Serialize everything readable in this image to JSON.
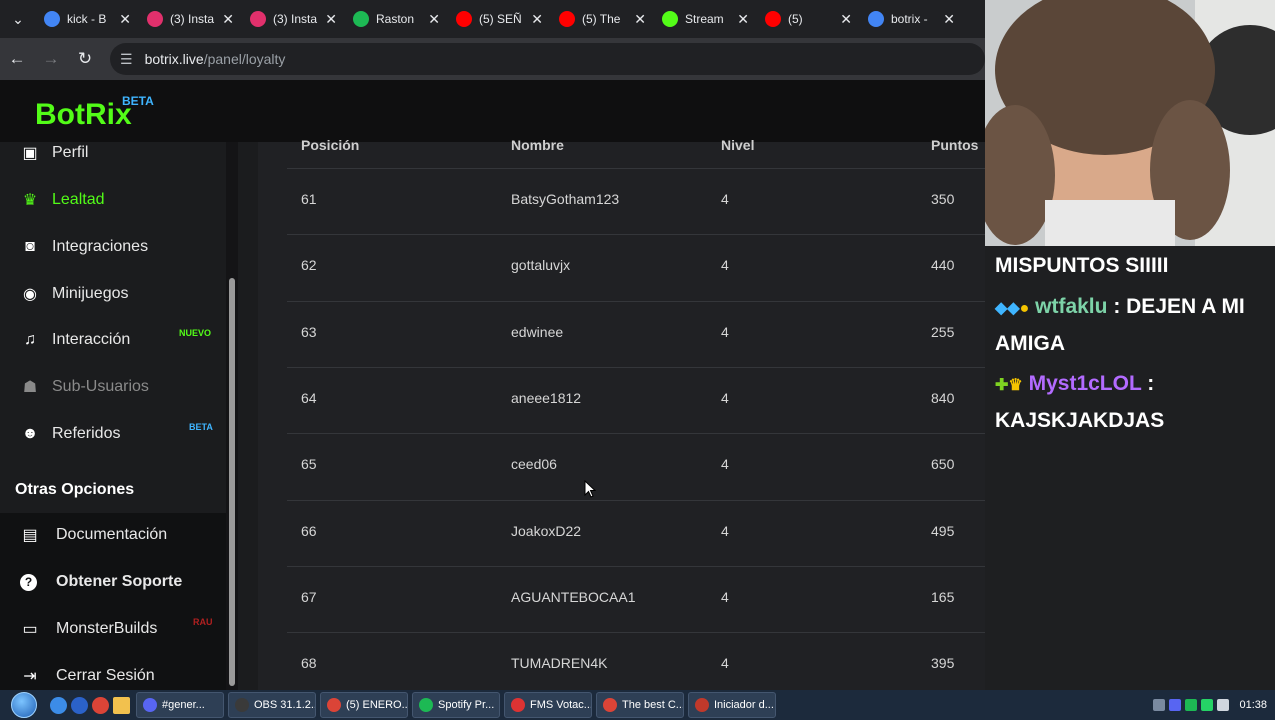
{
  "browser": {
    "tabs": [
      {
        "title": "kick - B",
        "color": "#4285f4"
      },
      {
        "title": "(3) Insta",
        "color": "#e1306c"
      },
      {
        "title": "(3) Insta",
        "color": "#e1306c"
      },
      {
        "title": "Raston",
        "color": "#1db954"
      },
      {
        "title": "(5) SEÑ",
        "color": "#ff0000"
      },
      {
        "title": "(5) The",
        "color": "#ff0000"
      },
      {
        "title": "Stream",
        "color": "#53fc18"
      },
      {
        "title": "(5)",
        "color": "#ff0000"
      },
      {
        "title": "botrix -",
        "color": "#4285f4"
      }
    ],
    "url_host": "botrix.live",
    "url_path": "/panel/loyalty"
  },
  "brand": {
    "name": "BotRix",
    "beta": "BETA",
    "accent": "#53fc18"
  },
  "sidebar": {
    "items": [
      {
        "label": "Perfil",
        "icon": "id-card-icon",
        "glyph": "▣"
      },
      {
        "label": "Lealtad",
        "icon": "trophy-icon",
        "glyph": "🏆"
      },
      {
        "label": "Integraciones",
        "icon": "discord-icon",
        "glyph": "◙"
      },
      {
        "label": "Minijuegos",
        "icon": "gamepad-icon",
        "glyph": "◉"
      },
      {
        "label": "Interacción",
        "icon": "music-note-icon",
        "glyph": "♫"
      },
      {
        "label": "Sub-Usuarios",
        "icon": "users-icon",
        "glyph": "☗"
      },
      {
        "label": "Referidos",
        "icon": "user-group-icon",
        "glyph": "☻"
      }
    ],
    "badges": {
      "nuevo": "NUEVO",
      "beta": "BETA",
      "rau": "RAU"
    },
    "section_title": "Otras Opciones",
    "other_items": [
      {
        "label": "Documentación",
        "icon": "book-icon",
        "glyph": "▤"
      },
      {
        "label": "Obtener Soporte",
        "icon": "help-circle-icon",
        "glyph": "?"
      },
      {
        "label": "MonsterBuilds",
        "icon": "laptop-icon",
        "glyph": "▭"
      },
      {
        "label": "Cerrar Sesión",
        "icon": "logout-icon",
        "glyph": "⇥"
      }
    ]
  },
  "table": {
    "headers": [
      "Posición",
      "Nombre",
      "Nivel",
      "Puntos"
    ],
    "rows": [
      {
        "pos": "61",
        "name": "BatsyGotham123",
        "level": "4",
        "points": "350"
      },
      {
        "pos": "62",
        "name": "gottaluvjx",
        "level": "4",
        "points": "440"
      },
      {
        "pos": "63",
        "name": "edwinee",
        "level": "4",
        "points": "255"
      },
      {
        "pos": "64",
        "name": "aneee1812",
        "level": "4",
        "points": "840"
      },
      {
        "pos": "65",
        "name": "ceed06",
        "level": "4",
        "points": "650"
      },
      {
        "pos": "66",
        "name": "JoakoxD22",
        "level": "4",
        "points": "495"
      },
      {
        "pos": "67",
        "name": "AGUANTEBOCAA1",
        "level": "4",
        "points": "165"
      },
      {
        "pos": "68",
        "name": "TUMADREN4K",
        "level": "4",
        "points": "395"
      }
    ]
  },
  "chat": {
    "line1": "MISPUNTOS SIIIII",
    "user2": "wtfaklu",
    "msg2": ": DEJEN A MI AMIGA",
    "user3": "Myst1cLOL",
    "msg3": ": KAJSKJAKDJAS",
    "user2_color": "#7dd3a8",
    "user3_color": "#b36bff"
  },
  "taskbar": {
    "tasks": [
      "#gener...",
      "OBS 31.1.2...",
      "(5) ENERO...",
      "Spotify Pr...",
      "FMS Votac...",
      "The best C...",
      "Iniciador d..."
    ],
    "clock": "01:38"
  }
}
